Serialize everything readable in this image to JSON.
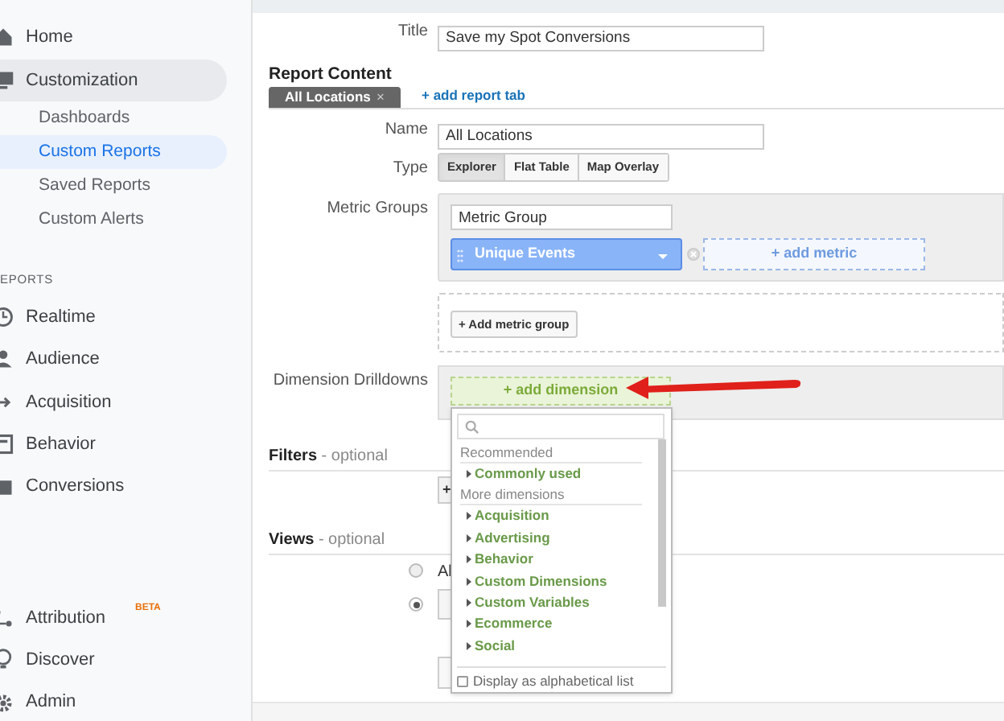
{
  "sidebar": {
    "top_items": [
      {
        "label": "Home",
        "selected": false
      },
      {
        "label": "Customization",
        "selected": true,
        "children": [
          {
            "label": "Dashboards",
            "selected": false
          },
          {
            "label": "Custom Reports",
            "selected": true
          },
          {
            "label": "Saved Reports",
            "selected": false
          },
          {
            "label": "Custom Alerts",
            "selected": false
          }
        ]
      }
    ],
    "reports_heading": "EPORTS",
    "reports_items": [
      {
        "label": "Realtime"
      },
      {
        "label": "Audience"
      },
      {
        "label": "Acquisition"
      },
      {
        "label": "Behavior"
      },
      {
        "label": "Conversions"
      }
    ],
    "bottom_items": [
      {
        "label": "Attribution",
        "badge": "BETA"
      },
      {
        "label": "Discover"
      },
      {
        "label": "Admin"
      }
    ]
  },
  "title_field": {
    "label": "Title",
    "value": "Save my Spot Conversions"
  },
  "report_content": {
    "heading": "Report Content",
    "tabs": [
      {
        "label": "All Locations",
        "selected": true,
        "close": "×"
      }
    ],
    "add_tab_link": "+ add report tab",
    "name_field": {
      "label": "Name",
      "value": "All Locations"
    },
    "type": {
      "label": "Type",
      "options": [
        {
          "label": "Explorer",
          "selected": true
        },
        {
          "label": "Flat Table",
          "selected": false
        },
        {
          "label": "Map Overlay",
          "selected": false
        }
      ]
    },
    "metric_groups": {
      "label": "Metric Groups",
      "group_name": "Metric Group",
      "metrics": [
        {
          "label": "Unique Events"
        }
      ],
      "add_metric": "+ add metric",
      "add_group_button": "+ Add metric group"
    },
    "dimension_drilldowns": {
      "label": "Dimension Drilldowns",
      "add_dimension": "+ add dimension",
      "dropdown": {
        "sections": [
          {
            "heading": "Recommended",
            "items": [
              "Commonly used"
            ]
          },
          {
            "heading": "More dimensions",
            "items": [
              "Acquisition",
              "Advertising",
              "Behavior",
              "Custom Dimensions",
              "Custom Variables",
              "Ecommerce",
              "Social"
            ]
          }
        ],
        "alphabetical": {
          "label": "Display as alphabetical list",
          "checked": false
        }
      }
    }
  },
  "filters": {
    "heading": "**Filters** - optional",
    "add_button": "+"
  },
  "views": {
    "heading": "**Views** - optional",
    "options": [
      {
        "label": "Al",
        "selected": false
      },
      {
        "selected": true
      }
    ]
  }
}
